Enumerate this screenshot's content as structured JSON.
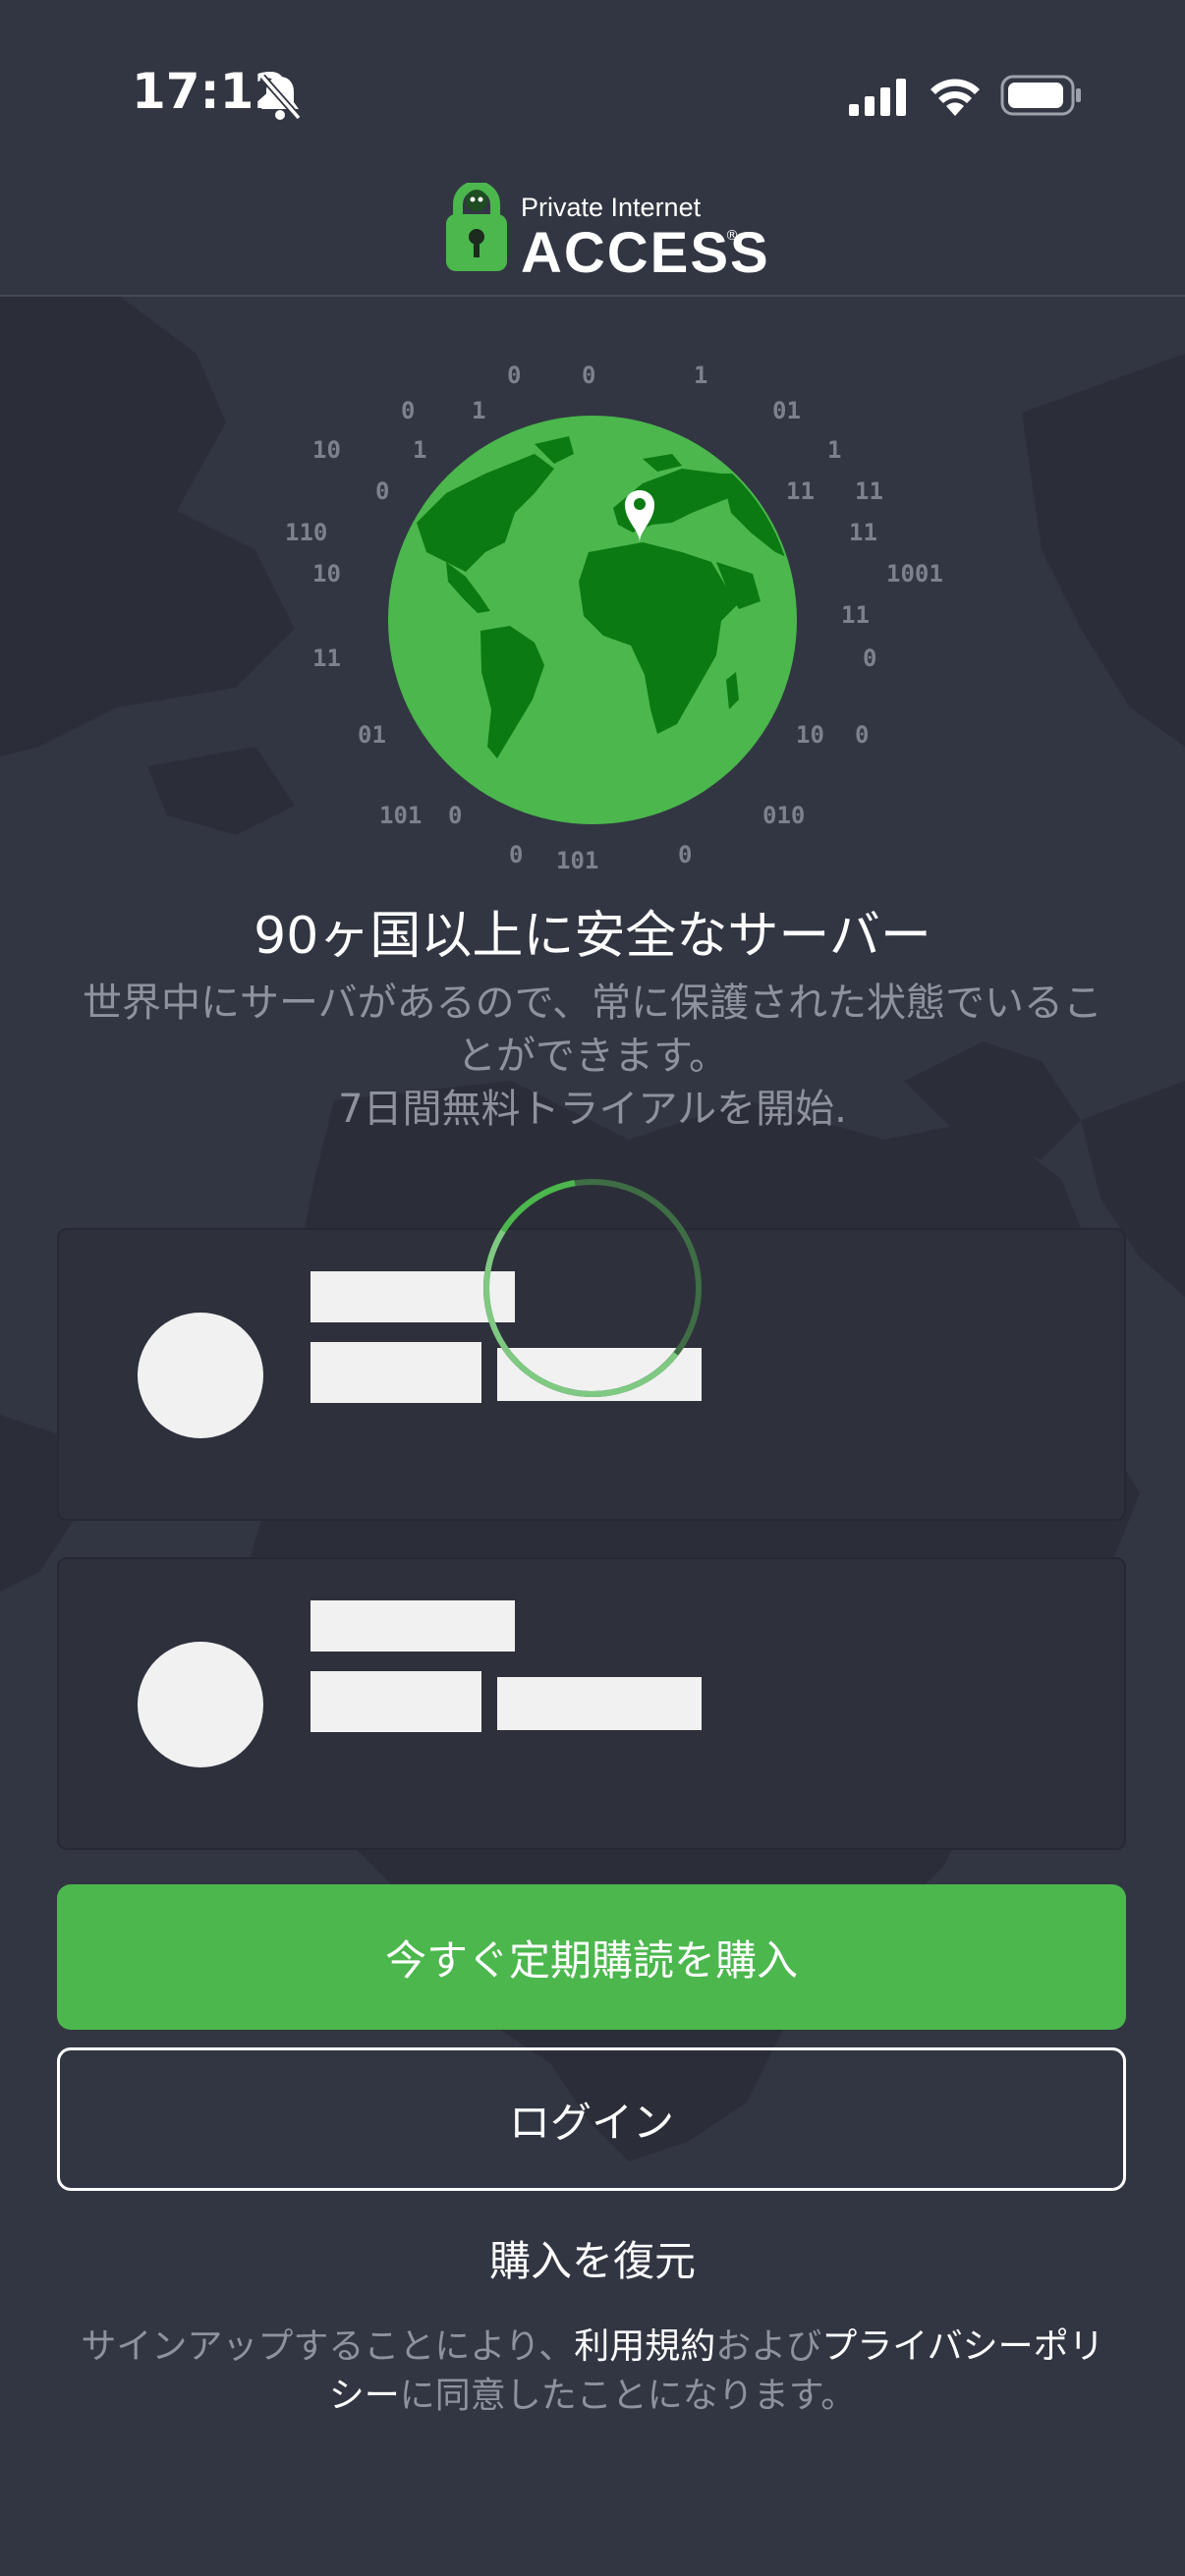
{
  "status_bar": {
    "time": "17:12",
    "icons": [
      "bell-slash-icon",
      "cellular-signal-icon",
      "wifi-icon",
      "battery-icon"
    ]
  },
  "header": {
    "logo_top": "Private Internet",
    "logo_main": "ACCESS",
    "logo_reg": "®"
  },
  "hero": {
    "binary_digits": [
      "0",
      "0",
      "1",
      "0",
      "1",
      "01",
      "10",
      "1",
      "1",
      "0",
      "11",
      "11",
      "110",
      "11",
      "10",
      "1001",
      "11",
      "11",
      "0",
      "01",
      "10",
      "0",
      "101",
      "0",
      "010",
      "0",
      "101",
      "0"
    ],
    "headline": "90ヶ国以上に安全なサーバー",
    "subtext_line1": "世界中にサーバがあるので、常に保護された状態でいるこ",
    "subtext_line2": "とができます。",
    "subtext_line3": "7日間無料トライアルを開始."
  },
  "plans": {
    "loading": true
  },
  "actions": {
    "buy_label": "今すぐ定期購読を購入",
    "login_label": "ログイン",
    "restore_label": "購入を復元"
  },
  "legal": {
    "prefix": "サインアップすることにより、",
    "terms_link": "利用規約",
    "and": "および",
    "privacy_link_1": "プライバシーポリ",
    "privacy_link_2": "シー",
    "suffix": "に同意したことになります。"
  },
  "colors": {
    "background": "#323642",
    "accent_green": "#4bb74d",
    "globe_land": "#0c7a12",
    "muted_text": "#8e929c"
  }
}
